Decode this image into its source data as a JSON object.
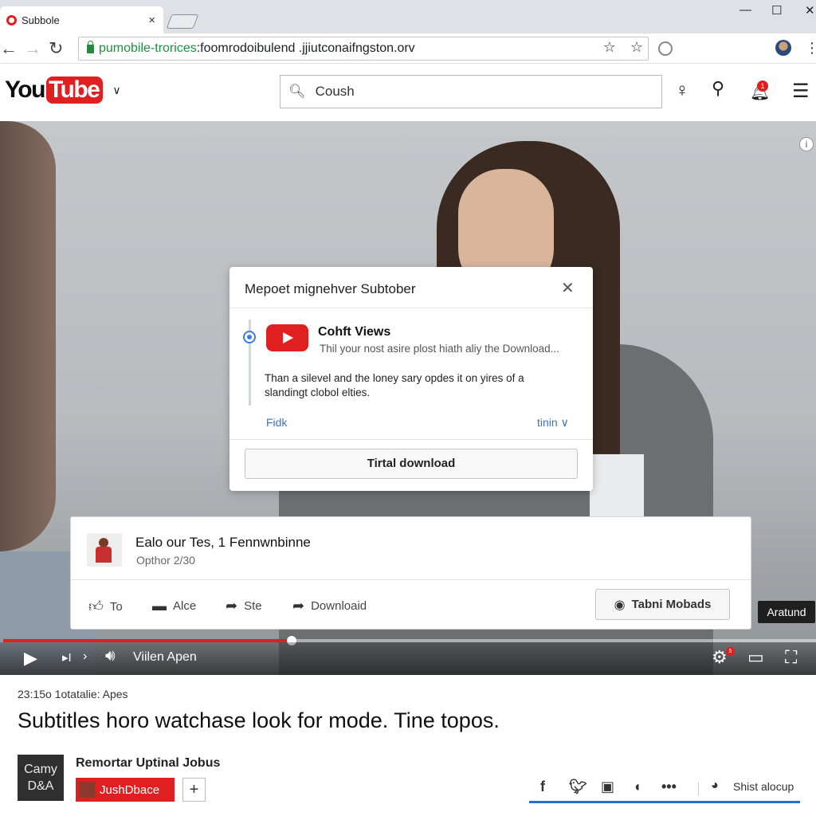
{
  "browser": {
    "tab_title": "Subbole",
    "tab_close": "×",
    "url_secure": "pumobile-trorices",
    "url_rest": ":foomrodoibulend .jjiutconaifngston.orv",
    "win_min": "—",
    "win_max": "☐",
    "win_close": "✕"
  },
  "youtube": {
    "logo_you": "You",
    "logo_tube": "Tube",
    "search_value": "Coush",
    "notification_count": "1"
  },
  "video": {
    "info_glyph": "i",
    "aratund_label": "Aratund",
    "control_text": "Viilen Apen",
    "progress_fraction": 0.355,
    "settings_badge": "5"
  },
  "dialog": {
    "title": "Mepoet mignehver Subtober",
    "heading": "Cohft Views",
    "subheading": "Thil your nost asire plost hiath aliy the Download...",
    "body": "Than a silevel and the loney sary opdes it on yires of a slandingt clobol elties.",
    "link_left": "Fidk",
    "link_right": "tinin ∨",
    "button": "Tirtal download"
  },
  "card": {
    "title": "Ealo our Tes, 1 Fennwnbinne",
    "subtitle": "Opthor 2/30",
    "actions": [
      {
        "label": "To",
        "icon": "thumbs-up-icon"
      },
      {
        "label": "Alce",
        "icon": "comment-icon"
      },
      {
        "label": "Ste",
        "icon": "share-icon"
      },
      {
        "label": "Downloaid",
        "icon": "download-icon"
      }
    ],
    "button": "Tabni Mobads"
  },
  "below": {
    "meta": "23:15o 1otatalie: Apes",
    "title": "Subtitles horo watchase look for mode. Tine topos.",
    "channel_avatar_line1": "Camy",
    "channel_avatar_line2": "D&A",
    "channel_name": "Remortar Uptinal Jobus",
    "subscribe_label": "JushDbace",
    "plus_label": "+",
    "share_text": "Shist alocup"
  },
  "colors": {
    "youtube_red": "#e02020",
    "link_blue": "#3b72c6",
    "secure_green": "#1e8e3e"
  }
}
